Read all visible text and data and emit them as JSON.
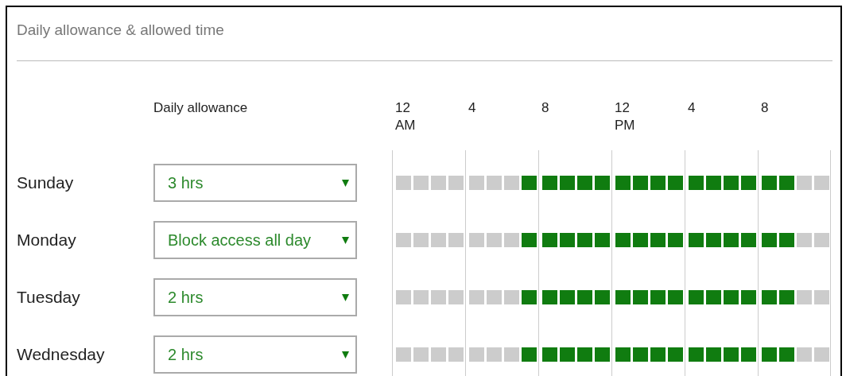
{
  "section": {
    "title": "Daily allowance & allowed time"
  },
  "allowance_header": "Daily allowance",
  "time_labels": [
    {
      "hour": "12",
      "period": "AM"
    },
    {
      "hour": "4"
    },
    {
      "hour": "8"
    },
    {
      "hour": "12",
      "period": "PM"
    },
    {
      "hour": "4"
    },
    {
      "hour": "8"
    }
  ],
  "days": [
    {
      "name": "Sunday",
      "allowance": "3 hrs",
      "slots": [
        false,
        false,
        false,
        false,
        false,
        false,
        false,
        true,
        true,
        true,
        true,
        true,
        true,
        true,
        true,
        true,
        true,
        true,
        true,
        true,
        true,
        true,
        false,
        false
      ]
    },
    {
      "name": "Monday",
      "allowance": "Block access all day",
      "slots": [
        false,
        false,
        false,
        false,
        false,
        false,
        false,
        true,
        true,
        true,
        true,
        true,
        true,
        true,
        true,
        true,
        true,
        true,
        true,
        true,
        true,
        true,
        false,
        false
      ]
    },
    {
      "name": "Tuesday",
      "allowance": "2 hrs",
      "slots": [
        false,
        false,
        false,
        false,
        false,
        false,
        false,
        true,
        true,
        true,
        true,
        true,
        true,
        true,
        true,
        true,
        true,
        true,
        true,
        true,
        true,
        true,
        false,
        false
      ]
    },
    {
      "name": "Wednesday",
      "allowance": "2 hrs",
      "slots": [
        false,
        false,
        false,
        false,
        false,
        false,
        false,
        true,
        true,
        true,
        true,
        true,
        true,
        true,
        true,
        true,
        true,
        true,
        true,
        true,
        true,
        true,
        false,
        false
      ]
    }
  ]
}
